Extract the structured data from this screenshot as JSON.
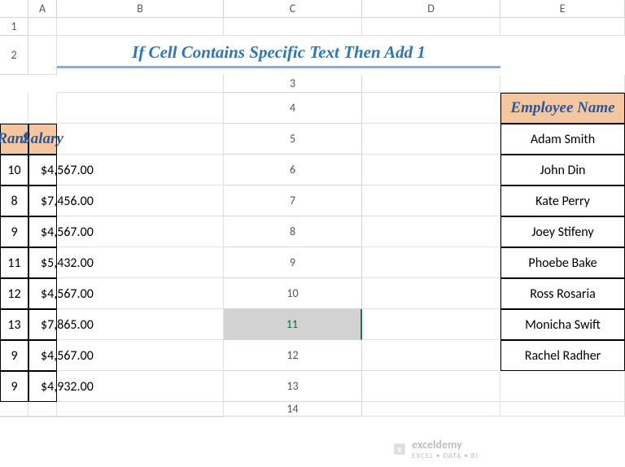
{
  "columns": [
    "",
    "A",
    "B",
    "C",
    "D",
    "E"
  ],
  "rows": [
    "1",
    "2",
    "3",
    "4",
    "5",
    "6",
    "7",
    "8",
    "9",
    "10",
    "11",
    "12",
    "13",
    "14"
  ],
  "selectedRow": "11",
  "title": "If Cell Contains Specific Text Then Add 1",
  "headers": {
    "name": "Employee Name",
    "rank": "Rank",
    "salary": "Salary"
  },
  "currency": "$",
  "employees": [
    {
      "name": "Adam Smith",
      "rank": "10",
      "salary": "4,567.00"
    },
    {
      "name": "John Din",
      "rank": "8",
      "salary": "7,456.00"
    },
    {
      "name": "Kate Perry",
      "rank": "9",
      "salary": "4,567.00"
    },
    {
      "name": "Joey Stifeny",
      "rank": "11",
      "salary": "5,432.00"
    },
    {
      "name": "Phoebe Bake",
      "rank": "12",
      "salary": "4,567.00"
    },
    {
      "name": "Ross Rosaria",
      "rank": "13",
      "salary": "7,865.00"
    },
    {
      "name": "Monicha Swift",
      "rank": "9",
      "salary": "4,567.00"
    },
    {
      "name": "Rachel Radher",
      "rank": "9",
      "salary": "4,932.00"
    }
  ],
  "watermark": {
    "brand": "exceldemy",
    "tagline": "EXCEL • DATA • BI"
  },
  "chart_data": {
    "type": "table",
    "title": "If Cell Contains Specific Text Then Add 1",
    "columns": [
      "Employee Name",
      "Rank",
      "Salary"
    ],
    "rows": [
      [
        "Adam Smith",
        10,
        4567.0
      ],
      [
        "John Din",
        8,
        7456.0
      ],
      [
        "Kate Perry",
        9,
        4567.0
      ],
      [
        "Joey Stifeny",
        11,
        5432.0
      ],
      [
        "Phoebe Bake",
        12,
        4567.0
      ],
      [
        "Ross Rosaria",
        13,
        7865.0
      ],
      [
        "Monicha Swift",
        9,
        4567.0
      ],
      [
        "Rachel Radher",
        9,
        4932.0
      ]
    ]
  }
}
